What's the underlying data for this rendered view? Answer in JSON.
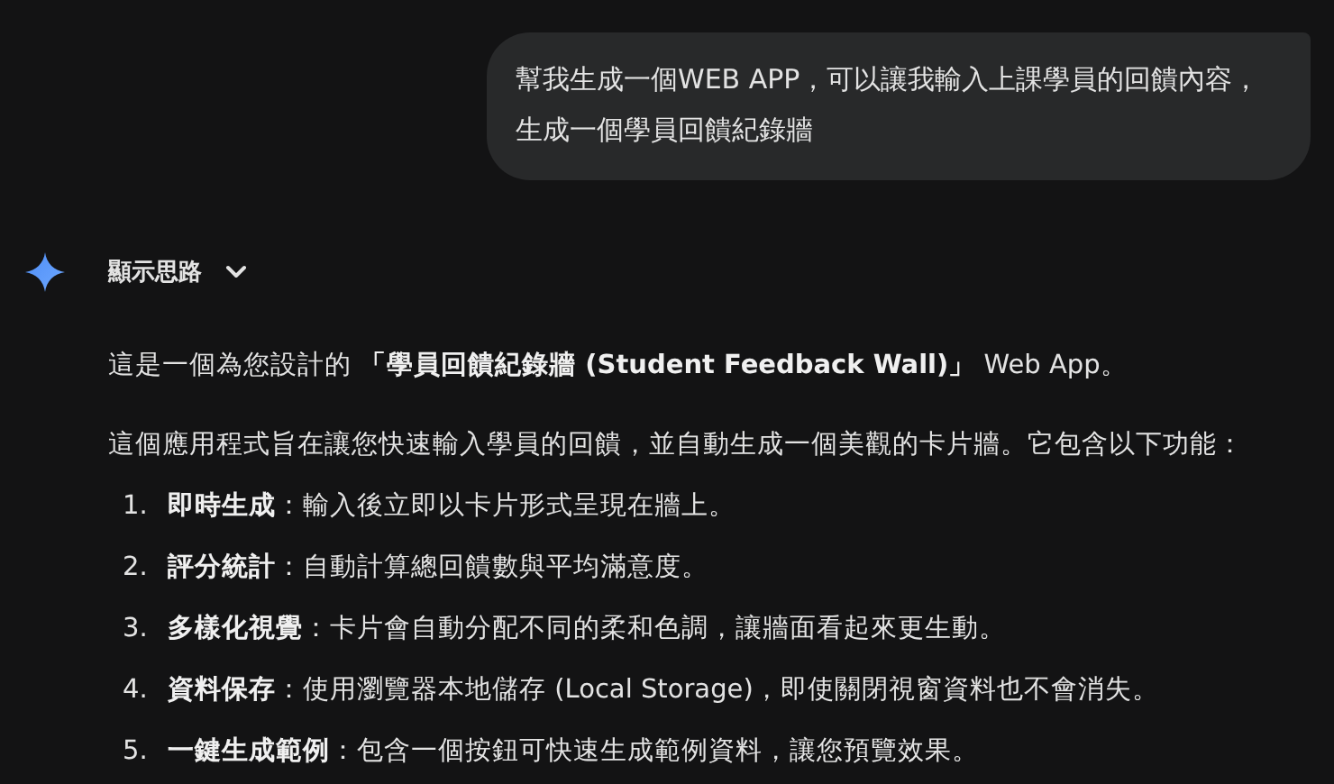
{
  "user_message": {
    "text": "幫我生成一個WEB APP，可以讓我輸入上課學員的回饋內容，生成一個學員回饋紀錄牆"
  },
  "thinking": {
    "label": "顯示思路",
    "expanded": false
  },
  "response": {
    "paragraphs": [
      "這是一個為您設計的 **「學員回饋紀錄牆 (Student Feedback Wall)」** Web App。",
      "這個應用程式旨在讓您快速輸入學員的回饋，並自動生成一個美觀的卡片牆。它包含以下功能："
    ],
    "list": [
      {
        "number": "1.",
        "text": "**即時生成**：輸入後立即以卡片形式呈現在牆上。"
      },
      {
        "number": "2.",
        "text": "**評分統計**：自動計算總回饋數與平均滿意度。"
      },
      {
        "number": "3.",
        "text": "**多樣化視覺**：卡片會自動分配不同的柔和色調，讓牆面看起來更生動。"
      },
      {
        "number": "4.",
        "text": "**資料保存**：使用瀏覽器本地儲存 (Local Storage)，即使關閉視窗資料也不會消失。"
      },
      {
        "number": "5.",
        "text": "**一鍵生成範例**：包含一個按鈕可快速生成範例資料，讓您預覽效果。"
      }
    ]
  }
}
